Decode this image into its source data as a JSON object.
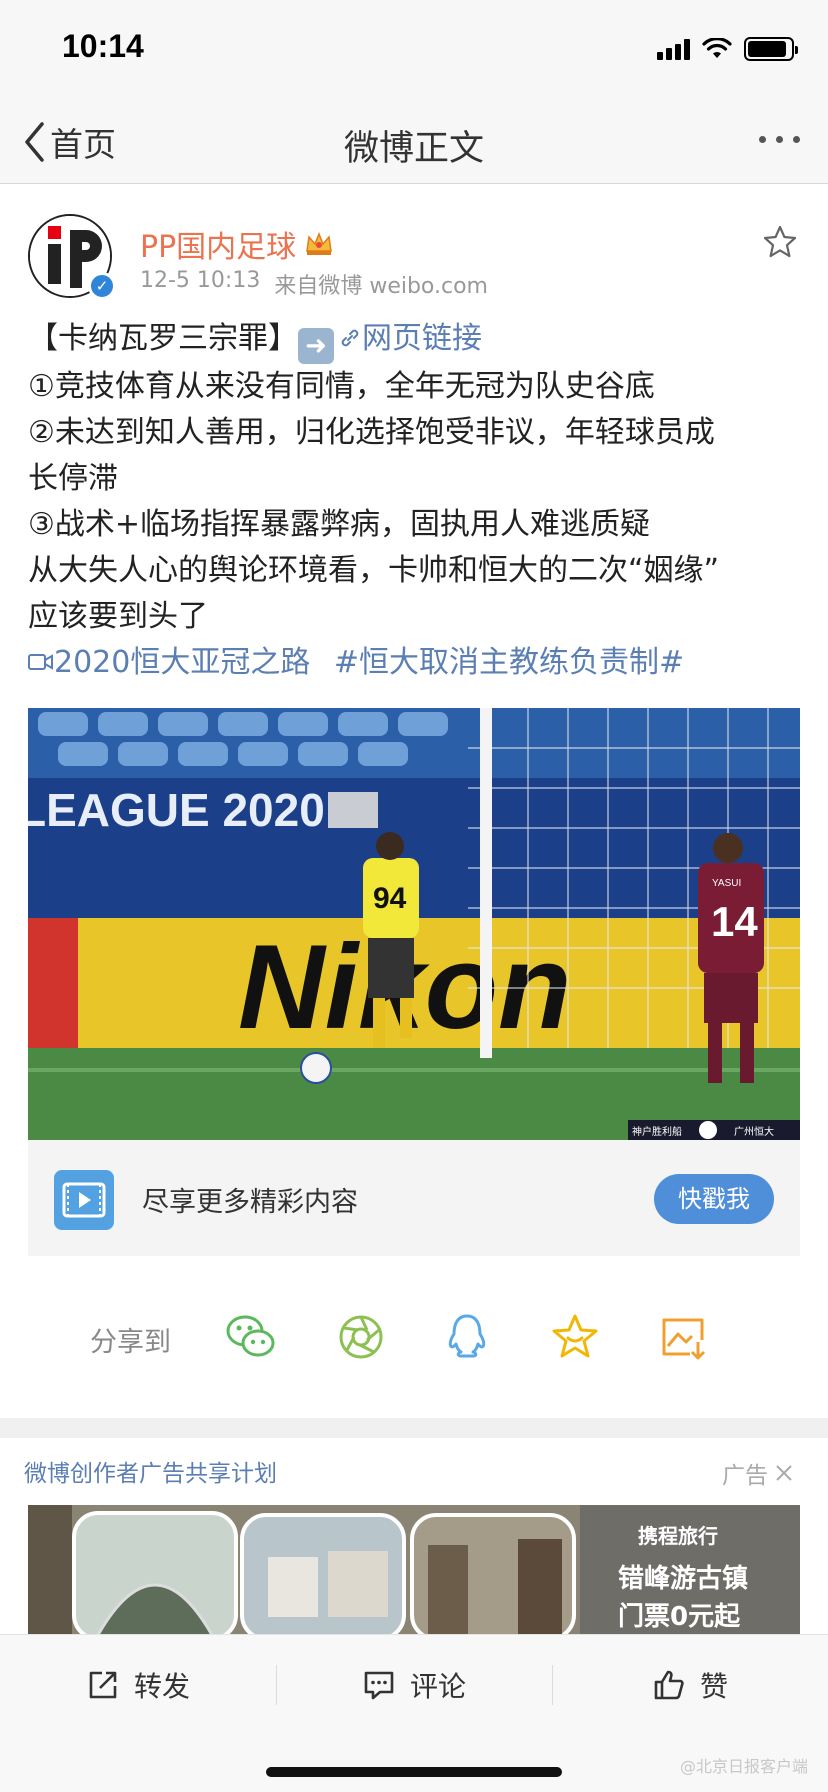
{
  "status_bar": {
    "time": "10:14"
  },
  "nav": {
    "back_label": "首页",
    "title": "微博正文"
  },
  "post": {
    "author": "PP国内足球",
    "date": "12-5 10:13",
    "source": "来自微博 weibo.com",
    "lines": {
      "l1_prefix": "【卡纳瓦罗三宗罪】",
      "l1_link": "网页链接",
      "l2": "①竞技体育从来没有同情，全年无冠为队史谷底",
      "l3": "②未达到知人善用，归化选择饱受非议，年轻球员成",
      "l4": "长停滞",
      "l5": "③战术+临场指挥暴露弊病，固执用人难逃质疑",
      "l6": "从大失人心的舆论环境看，卡帅和恒大的二次“姻缘”",
      "l7": "应该要到头了"
    },
    "topic_1": "2020恒大亚冠之路",
    "topic_2": "#恒大取消主教练负责制#"
  },
  "video": {
    "board_text": "LEAGUE 2020",
    "sponsor_text": "Nikon",
    "player_left_number": "94",
    "player_right_number": "14",
    "player_right_name": "YASUI",
    "score_left": "神户胜利船",
    "score_right": "广州恒大"
  },
  "promo": {
    "text": "尽享更多精彩内容",
    "button": "快戳我"
  },
  "share": {
    "label": "分享到"
  },
  "ad": {
    "title": "微博创作者广告共享计划",
    "label": "广告",
    "brand": "携程旅行",
    "headline_1": "错峰游古镇",
    "headline_2": "门票0元起"
  },
  "actions": {
    "repost": "转发",
    "comment": "评论",
    "like": "赞"
  },
  "watermark": "@北京日报客户端",
  "colors": {
    "author": "#eb7350",
    "link": "#5b7fb3",
    "button": "#4f8ed8"
  }
}
